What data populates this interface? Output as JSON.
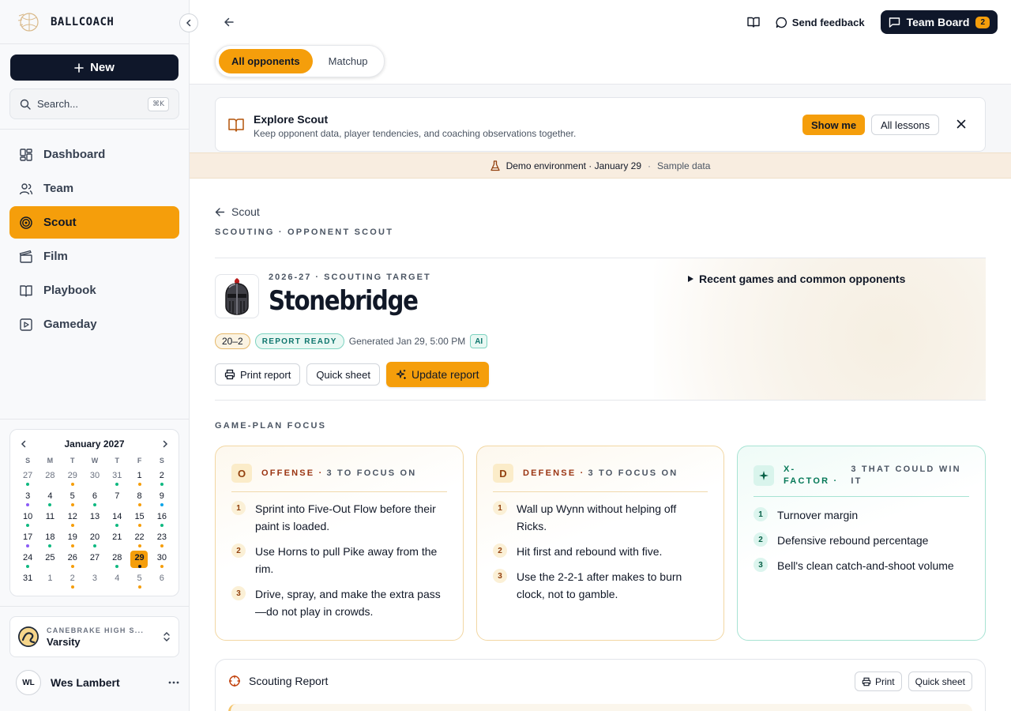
{
  "brand": {
    "name": "BALLCOACH"
  },
  "sidebar": {
    "new_label": "New",
    "search_placeholder": "Search...",
    "search_shortcut": "⌘K",
    "nav": [
      {
        "label": "Dashboard",
        "icon": "dashboard-icon"
      },
      {
        "label": "Team",
        "icon": "users-icon"
      },
      {
        "label": "Scout",
        "icon": "target-icon",
        "active": true
      },
      {
        "label": "Film",
        "icon": "clapperboard-icon"
      },
      {
        "label": "Playbook",
        "icon": "book-icon"
      },
      {
        "label": "Gameday",
        "icon": "play-square-icon"
      }
    ],
    "calendar": {
      "month": "January 2027",
      "dow": [
        "S",
        "M",
        "T",
        "W",
        "T",
        "F",
        "S"
      ],
      "days": [
        {
          "n": "27",
          "other": true,
          "dot": "#10b981"
        },
        {
          "n": "28",
          "other": true
        },
        {
          "n": "29",
          "other": true,
          "dot": "#f59e0b"
        },
        {
          "n": "30",
          "other": true
        },
        {
          "n": "31",
          "other": true,
          "dot": "#10b981"
        },
        {
          "n": "1",
          "dot": "#f59e0b"
        },
        {
          "n": "2",
          "dot": "#10b981"
        },
        {
          "n": "3",
          "dot": "#8b5cf6"
        },
        {
          "n": "4",
          "dot": "#10b981"
        },
        {
          "n": "5",
          "dot": "#f59e0b"
        },
        {
          "n": "6",
          "dot": "#10b981"
        },
        {
          "n": "7"
        },
        {
          "n": "8",
          "dot": "#f59e0b"
        },
        {
          "n": "9",
          "dot": "#0ea5e9"
        },
        {
          "n": "10",
          "dot": "#10b981"
        },
        {
          "n": "11"
        },
        {
          "n": "12",
          "dot": "#f59e0b"
        },
        {
          "n": "13"
        },
        {
          "n": "14",
          "dot": "#10b981"
        },
        {
          "n": "15",
          "dot": "#f59e0b"
        },
        {
          "n": "16",
          "dot": "#10b981"
        },
        {
          "n": "17",
          "dot": "#8b5cf6"
        },
        {
          "n": "18",
          "dot": "#10b981"
        },
        {
          "n": "19",
          "dot": "#f59e0b"
        },
        {
          "n": "20",
          "dot": "#10b981"
        },
        {
          "n": "21"
        },
        {
          "n": "22",
          "dot": "#f59e0b"
        },
        {
          "n": "23",
          "dot": "#f59e0b"
        },
        {
          "n": "24",
          "dot": "#10b981"
        },
        {
          "n": "25"
        },
        {
          "n": "26",
          "dot": "#f59e0b"
        },
        {
          "n": "27"
        },
        {
          "n": "28",
          "dot": "#10b981"
        },
        {
          "n": "29",
          "today": true,
          "dot": "#111827"
        },
        {
          "n": "30",
          "dot": "#f59e0b"
        },
        {
          "n": "31"
        },
        {
          "n": "1",
          "other": true
        },
        {
          "n": "2",
          "other": true,
          "dot": "#f59e0b"
        },
        {
          "n": "3",
          "other": true
        },
        {
          "n": "4",
          "other": true
        },
        {
          "n": "5",
          "other": true,
          "dot": "#f59e0b"
        },
        {
          "n": "6",
          "other": true
        }
      ]
    },
    "team": {
      "school": "CANEBRAKE HIGH S...",
      "level": "Varsity"
    },
    "user": {
      "initials": "WL",
      "name": "Wes Lambert"
    }
  },
  "topbar": {
    "feedback_label": "Send feedback",
    "team_board_label": "Team Board",
    "team_board_count": "2",
    "segments": [
      "All opponents",
      "Matchup"
    ]
  },
  "explore": {
    "title": "Explore Scout",
    "subtitle": "Keep opponent data, player tendencies, and coaching observations together.",
    "show_me": "Show me",
    "all_lessons": "All lessons"
  },
  "demo": {
    "text": "Demo environment · January 29",
    "sep": "·",
    "sample": "Sample data"
  },
  "page": {
    "back_label": "Scout",
    "eyebrow": "SCOUTING · OPPONENT SCOUT",
    "hero_eyebrow": "2026-27 · SCOUTING TARGET",
    "title": "Stonebridge",
    "recent_label": "Recent games and common opponents",
    "record": "20–2",
    "status": "REPORT READY",
    "generated": "Generated Jan 29, 5:00 PM",
    "ai": "AI",
    "print_report": "Print report",
    "quick_sheet": "Quick sheet",
    "update_report": "Update report"
  },
  "gameplan": {
    "label": "GAME-PLAN FOCUS",
    "offense": {
      "letter": "O",
      "title": "OFFENSE ·",
      "sub": "3 TO FOCUS ON",
      "items": [
        "Sprint into Five-Out Flow before their paint is loaded.",
        "Use Horns to pull Pike away from the rim.",
        "Drive, spray, and make the extra pass—do not play in crowds."
      ]
    },
    "defense": {
      "letter": "D",
      "title": "DEFENSE ·",
      "sub": "3 TO FOCUS ON",
      "items": [
        "Wall up Wynn without helping off Ricks.",
        "Hit first and rebound with five.",
        "Use the 2-2-1 after makes to burn clock, not to gamble."
      ]
    },
    "xfactor": {
      "title": "X-FACTOR ·",
      "sub": "3 THAT COULD WIN IT",
      "items": [
        "Turnover margin",
        "Defensive rebound percentage",
        "Bell's clean catch-and-shoot volume"
      ]
    }
  },
  "report": {
    "title": "Scouting Report",
    "print": "Print",
    "quick_sheet": "Quick sheet"
  },
  "colors": {
    "accent": "#f59e0b",
    "dark": "#0f172a",
    "teal": "#047857"
  }
}
